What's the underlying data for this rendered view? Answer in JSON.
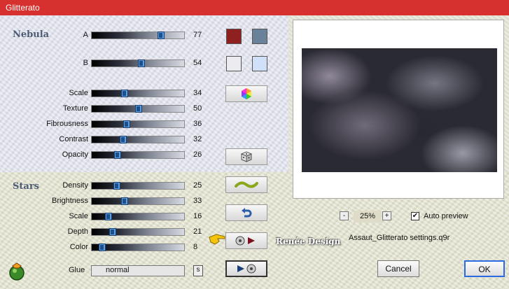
{
  "window": {
    "title": "Glitterato"
  },
  "nebula": {
    "title": "Nebula",
    "sliders": [
      {
        "label": "A",
        "value": "77"
      },
      {
        "label": "B",
        "value": "54"
      },
      {
        "label": "Scale",
        "value": "34"
      },
      {
        "label": "Texture",
        "value": "50"
      },
      {
        "label": "Fibrousness",
        "value": "36"
      },
      {
        "label": "Contrast",
        "value": "32"
      },
      {
        "label": "Opacity",
        "value": "26"
      }
    ],
    "colors": {
      "a_primary": "#8e2020",
      "a_secondary": "#6a8299",
      "b_primary": "#e8e8ee",
      "b_secondary": "#cfe0f8"
    }
  },
  "stars": {
    "title": "Stars",
    "sliders": [
      {
        "label": "Density",
        "value": "25"
      },
      {
        "label": "Brightness",
        "value": "33"
      },
      {
        "label": "Scale",
        "value": "16"
      },
      {
        "label": "Depth",
        "value": "21"
      },
      {
        "label": "Color",
        "value": "8"
      }
    ]
  },
  "glue": {
    "label": "Glue",
    "value": "normal",
    "s_label": "s"
  },
  "preview": {
    "zoom": "25%",
    "zoom_minus": "-",
    "zoom_plus": "+",
    "auto_preview_label": "Auto preview",
    "auto_preview_checked": "✔",
    "settings_file": "Assaut_Glitterato settings.q9r"
  },
  "buttons": {
    "cancel": "Cancel",
    "ok": "OK"
  },
  "watermark": "Renée Design"
}
